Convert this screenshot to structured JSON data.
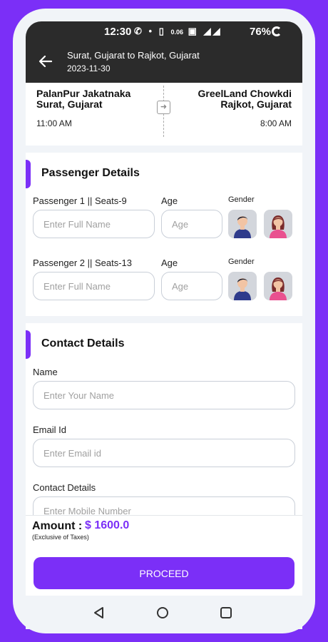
{
  "status_bar": {
    "time": "12:30",
    "icons": [
      "whatsapp-icon",
      "dot-icon",
      "vibrate-icon",
      "data-speed-icon",
      "volte-icon",
      "signal-icon",
      "signal-icon"
    ],
    "net_speed": "0.06",
    "battery": "76%"
  },
  "app_bar": {
    "route": "Surat, Gujarat  to  Rajkot, Gujarat",
    "date": "2023-11-30"
  },
  "journey": {
    "from_place_line1": "PalanPur Jakatnaka",
    "from_place_line2": "Surat, Gujarat",
    "from_time": "11:00 AM",
    "to_place_line1": "GreelLand Chowkdi",
    "to_place_line2": "Rajkot, Gujarat",
    "to_time": "8:00 AM"
  },
  "passenger_details": {
    "title": "Passenger Details",
    "passengers": [
      {
        "label": "Passenger 1 || Seats-9",
        "name_placeholder": "Enter Full Name",
        "age_label": "Age",
        "age_placeholder": "Age",
        "gender_label": "Gender"
      },
      {
        "label": "Passenger 2 || Seats-13",
        "name_placeholder": "Enter Full Name",
        "age_label": "Age",
        "age_placeholder": "Age",
        "gender_label": "Gender"
      }
    ]
  },
  "contact_details": {
    "title": "Contact Details",
    "name_label": "Name",
    "name_placeholder": "Enter Your Name",
    "email_label": "Email Id",
    "email_placeholder": "Enter Email id",
    "phone_label": "Contact Details",
    "phone_placeholder": "Enter Mobile Number"
  },
  "footer": {
    "amount_label": "Amount :",
    "amount_value": "$ 1600.0",
    "amount_note": "(Exclusive of Taxes)",
    "proceed_label": "PROCEED"
  },
  "colors": {
    "accent": "#7b2ff7",
    "dark_bar": "#2b2b2b",
    "page_bg": "#f1f4f8"
  }
}
